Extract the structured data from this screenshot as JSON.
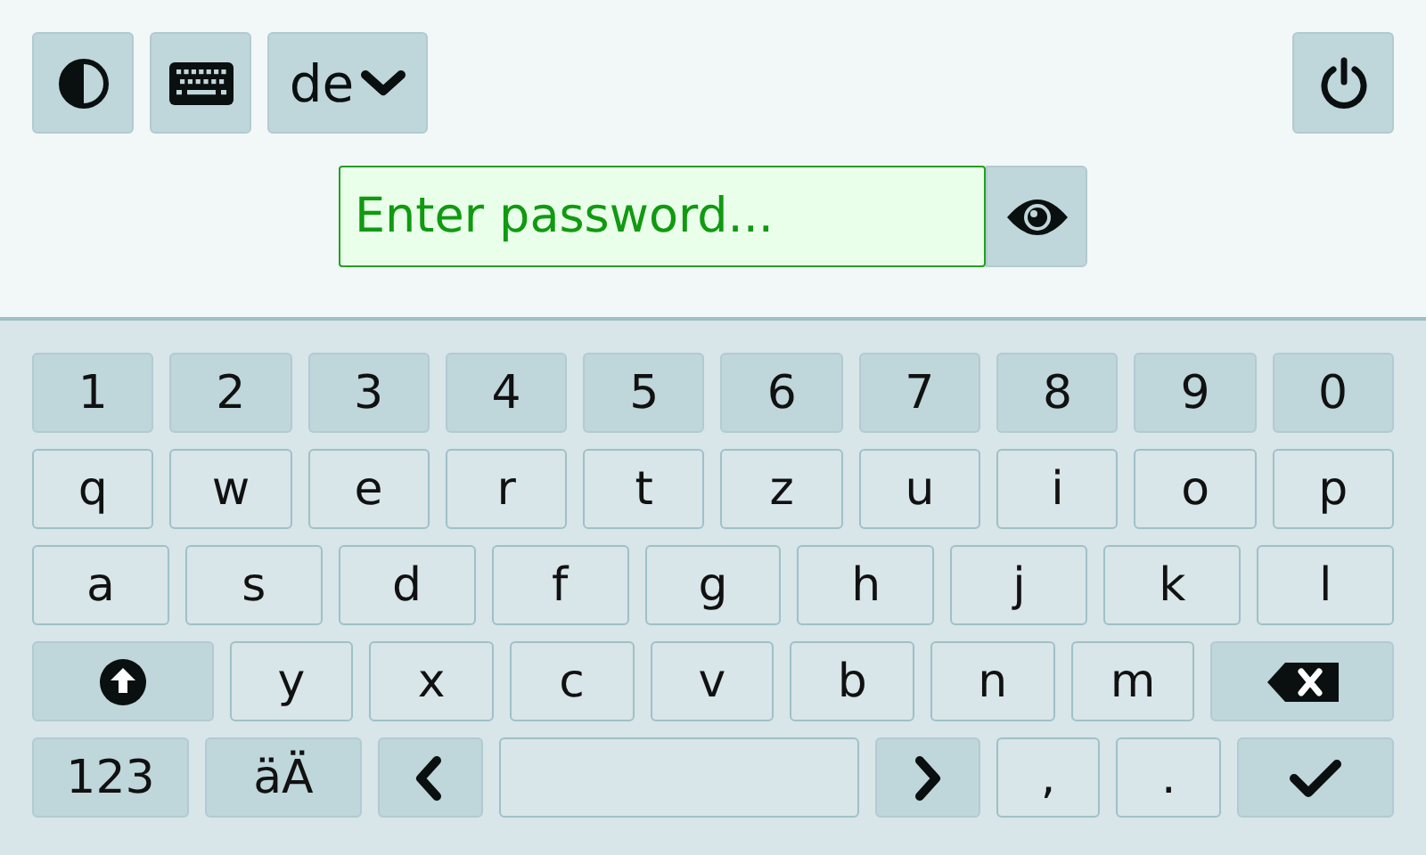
{
  "toolbar": {
    "language": "de"
  },
  "password": {
    "placeholder": "Enter password..."
  },
  "keyboard": {
    "rows": [
      {
        "keys": [
          {
            "kind": "digit",
            "label": "1"
          },
          {
            "kind": "digit",
            "label": "2"
          },
          {
            "kind": "digit",
            "label": "3"
          },
          {
            "kind": "digit",
            "label": "4"
          },
          {
            "kind": "digit",
            "label": "5"
          },
          {
            "kind": "digit",
            "label": "6"
          },
          {
            "kind": "digit",
            "label": "7"
          },
          {
            "kind": "digit",
            "label": "8"
          },
          {
            "kind": "digit",
            "label": "9"
          },
          {
            "kind": "digit",
            "label": "0"
          }
        ]
      },
      {
        "keys": [
          {
            "kind": "char",
            "label": "q"
          },
          {
            "kind": "char",
            "label": "w"
          },
          {
            "kind": "char",
            "label": "e"
          },
          {
            "kind": "char",
            "label": "r"
          },
          {
            "kind": "char",
            "label": "t"
          },
          {
            "kind": "char",
            "label": "z"
          },
          {
            "kind": "char",
            "label": "u"
          },
          {
            "kind": "char",
            "label": "i"
          },
          {
            "kind": "char",
            "label": "o"
          },
          {
            "kind": "char",
            "label": "p"
          }
        ]
      },
      {
        "keys": [
          {
            "kind": "char",
            "label": "a"
          },
          {
            "kind": "char",
            "label": "s"
          },
          {
            "kind": "char",
            "label": "d"
          },
          {
            "kind": "char",
            "label": "f"
          },
          {
            "kind": "char",
            "label": "g"
          },
          {
            "kind": "char",
            "label": "h"
          },
          {
            "kind": "char",
            "label": "j"
          },
          {
            "kind": "char",
            "label": "k"
          },
          {
            "kind": "char",
            "label": "l"
          }
        ]
      },
      {
        "keys": [
          {
            "kind": "shift"
          },
          {
            "kind": "char",
            "label": "y"
          },
          {
            "kind": "char",
            "label": "x"
          },
          {
            "kind": "char",
            "label": "c"
          },
          {
            "kind": "char",
            "label": "v"
          },
          {
            "kind": "char",
            "label": "b"
          },
          {
            "kind": "char",
            "label": "n"
          },
          {
            "kind": "char",
            "label": "m"
          },
          {
            "kind": "backspace"
          }
        ]
      },
      {
        "keys": [
          {
            "kind": "mode",
            "label": "123"
          },
          {
            "kind": "mode",
            "label": "äÄ"
          },
          {
            "kind": "left"
          },
          {
            "kind": "space"
          },
          {
            "kind": "right"
          },
          {
            "kind": "char",
            "label": ","
          },
          {
            "kind": "char",
            "label": "."
          },
          {
            "kind": "enter"
          }
        ]
      }
    ]
  }
}
